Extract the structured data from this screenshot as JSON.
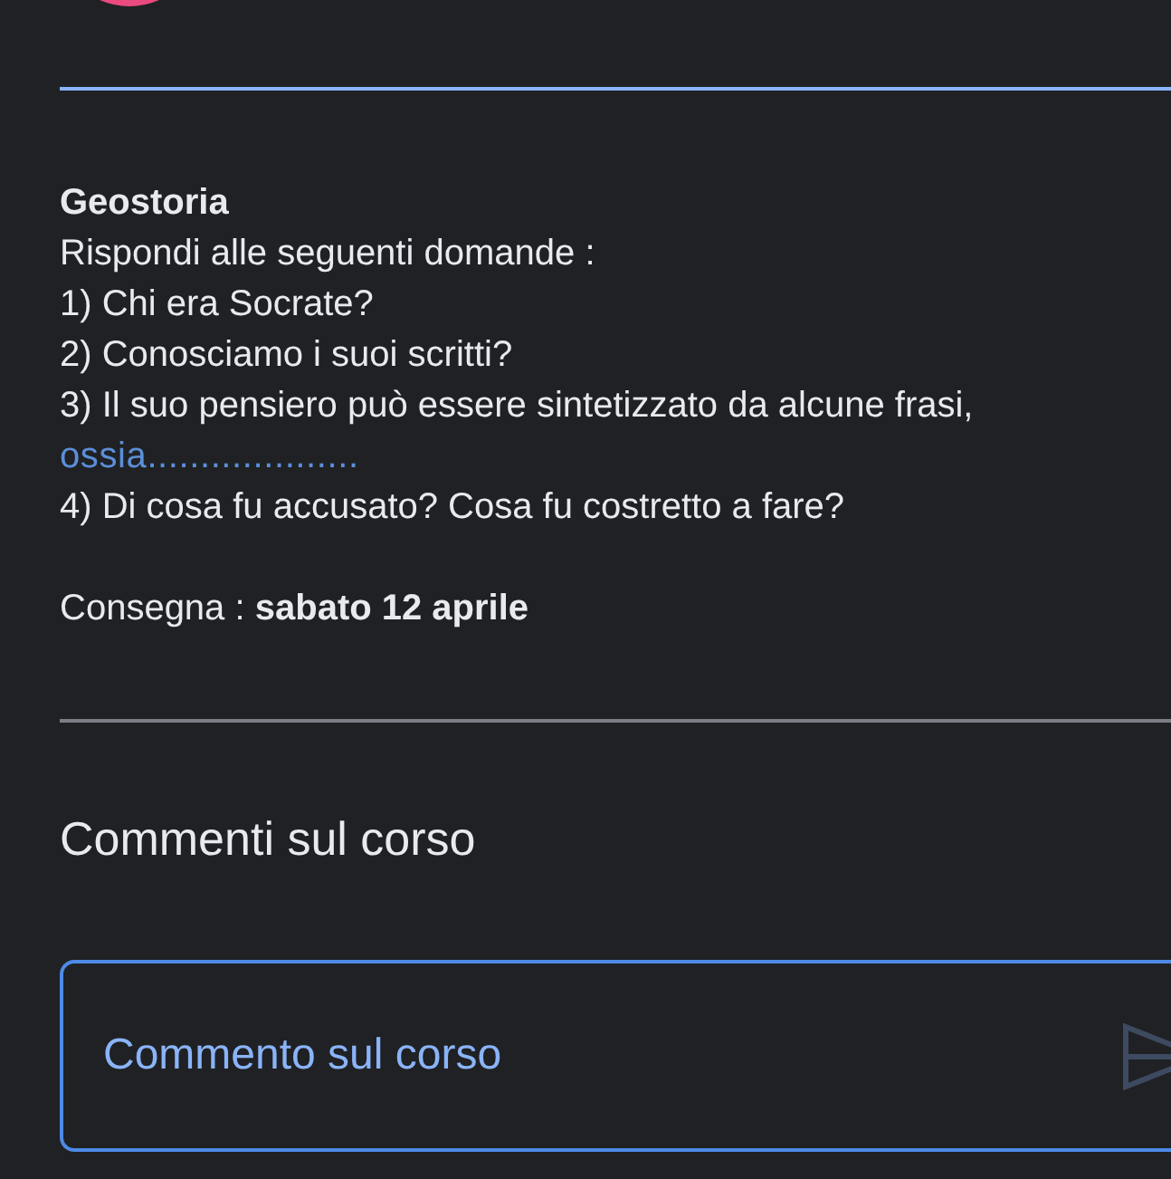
{
  "assignment": {
    "subject": "Geostoria",
    "instructions": "Rispondi alle seguenti domande :",
    "questions": [
      {
        "text": "1) Chi era Socrate?"
      },
      {
        "text": "2) Conosciamo i suoi scritti?"
      },
      {
        "text": "3) Il suo pensiero può essere sintetizzato da alcune frasi,",
        "link": "ossia...................."
      },
      {
        "text": "4) Di cosa fu accusato? Cosa fu costretto a fare?"
      }
    ],
    "due": "Consegna : **sabato 12 aprile**"
  },
  "comments": {
    "title": "Commenti sul corso",
    "input": {
      "placeholder": "Commento sul corso"
    }
  }
}
